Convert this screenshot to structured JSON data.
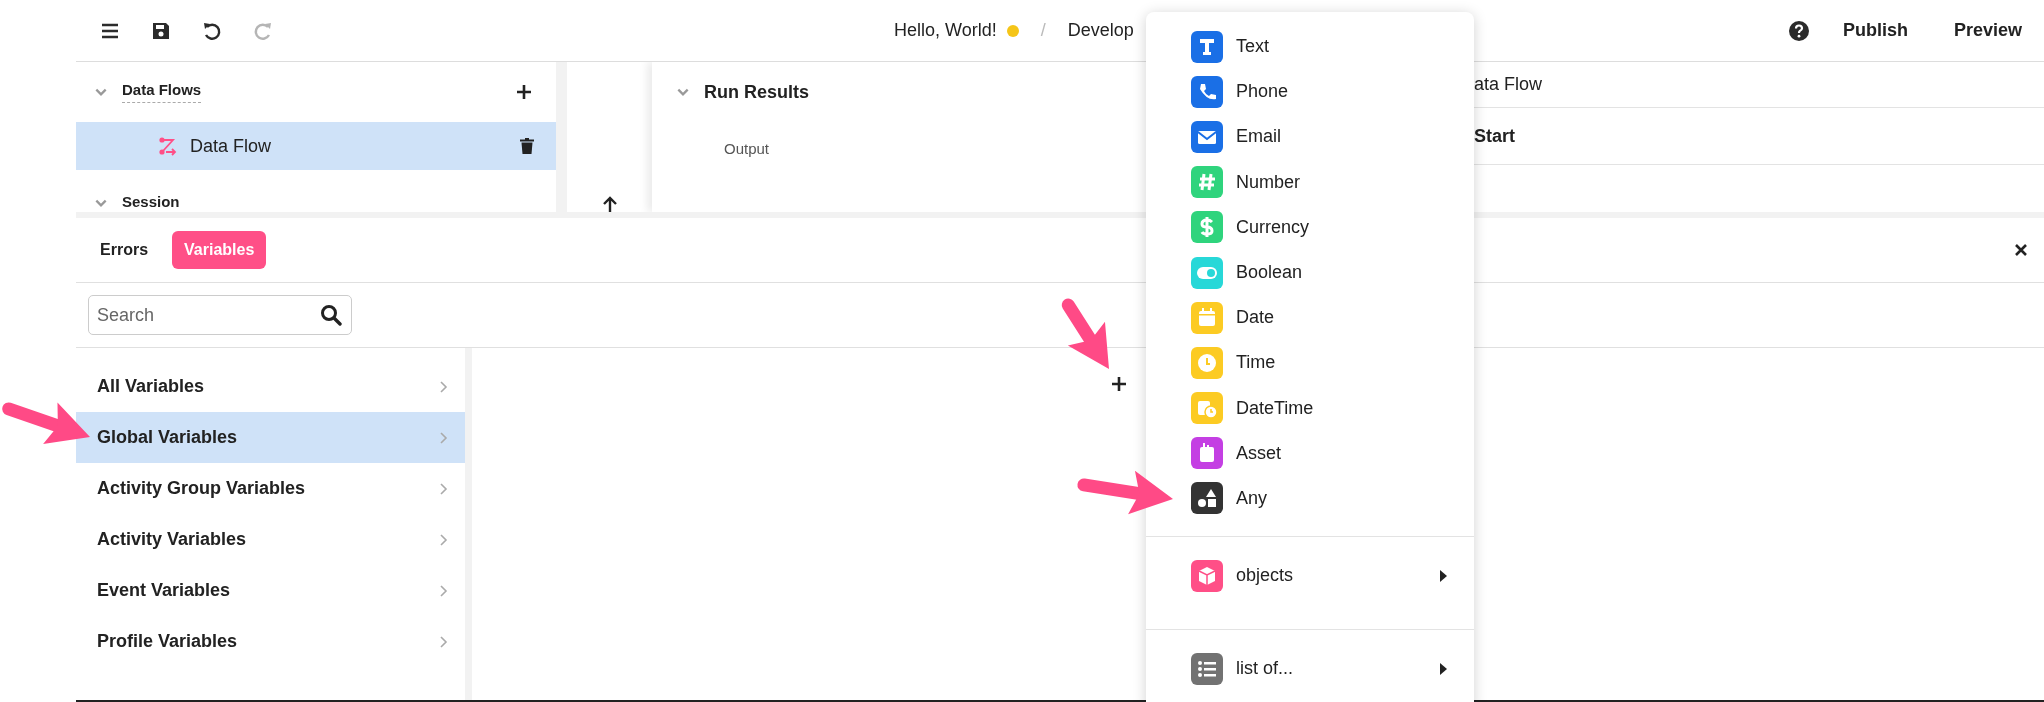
{
  "toolbar": {
    "buttons": [
      {
        "kind": "menu",
        "disabled": false
      },
      {
        "kind": "save",
        "disabled": false
      },
      {
        "kind": "undo",
        "disabled": false
      },
      {
        "kind": "redo",
        "disabled": true
      }
    ],
    "title": "Hello, World!",
    "separator": "/",
    "breadcrumb": "Develop",
    "actions": [
      "Publish",
      "Preview"
    ]
  },
  "tree": {
    "sections": [
      {
        "label": "Data Flows",
        "expanded": true,
        "children": [
          {
            "label": "Data Flow",
            "selected": true
          }
        ]
      },
      {
        "label": "Session",
        "expanded": true
      }
    ]
  },
  "run_results": {
    "title": "Run Results",
    "output_label": "Output"
  },
  "flow_panel": {
    "title": "ata Flow",
    "node": "Start"
  },
  "bottom_panel": {
    "tabs": [
      {
        "label": "Errors",
        "selected": false
      },
      {
        "label": "Variables",
        "selected": true
      }
    ],
    "search": {
      "placeholder": "Search"
    },
    "categories": [
      {
        "label": "All Variables",
        "selected": false
      },
      {
        "label": "Global Variables",
        "selected": true
      },
      {
        "label": "Activity Group Variables",
        "selected": false
      },
      {
        "label": "Activity Variables",
        "selected": false
      },
      {
        "label": "Event Variables",
        "selected": false
      },
      {
        "label": "Profile Variables",
        "selected": false
      }
    ]
  },
  "type_menu": {
    "items": [
      {
        "label": "Text",
        "kind": "text",
        "color": "#1a6fe6"
      },
      {
        "label": "Phone",
        "kind": "phone",
        "color": "#1a6fe6"
      },
      {
        "label": "Email",
        "kind": "email",
        "color": "#1a6fe6"
      },
      {
        "label": "Number",
        "kind": "number",
        "color": "#2fd47d"
      },
      {
        "label": "Currency",
        "kind": "currency",
        "color": "#2fd47d"
      },
      {
        "label": "Boolean",
        "kind": "boolean",
        "color": "#27d8d8"
      },
      {
        "label": "Date",
        "kind": "date",
        "color": "#fccb23"
      },
      {
        "label": "Time",
        "kind": "time",
        "color": "#fccb23"
      },
      {
        "label": "DateTime",
        "kind": "datetime",
        "color": "#fccb23"
      },
      {
        "label": "Asset",
        "kind": "asset",
        "color": "#c43fe3"
      },
      {
        "label": "Any",
        "kind": "any",
        "color": "#333333"
      }
    ],
    "groups": [
      {
        "label": "objects",
        "kind": "objects",
        "color": "#ff4f87"
      },
      {
        "label": "list of...",
        "kind": "list",
        "color": "#727272"
      }
    ]
  },
  "annotations": [
    {
      "kind": "arrow"
    },
    {
      "kind": "arrow"
    },
    {
      "kind": "arrow"
    }
  ]
}
